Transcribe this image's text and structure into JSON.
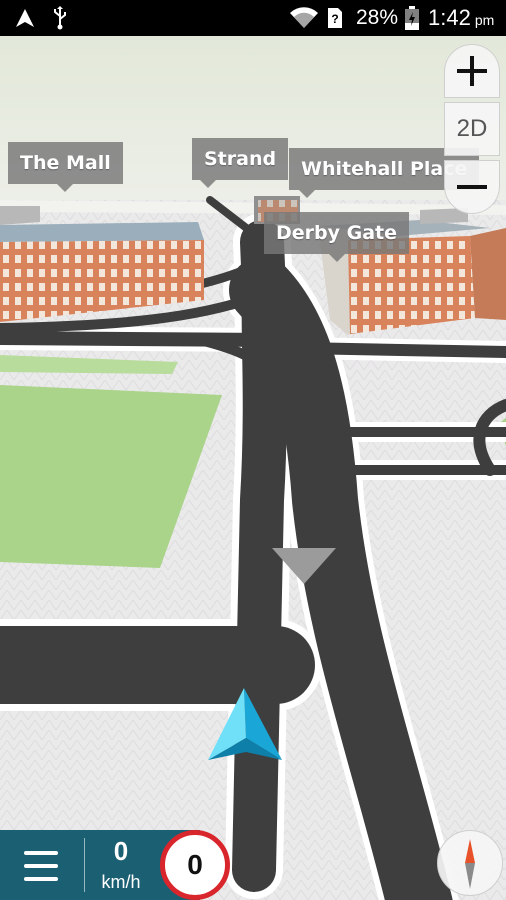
{
  "status_bar": {
    "battery": "28%",
    "time": "1:42",
    "ampm": "pm",
    "icons": [
      "navigation-arrow-icon",
      "usb-icon",
      "wifi-icon",
      "sim-alert-icon",
      "battery-charging-icon"
    ]
  },
  "map": {
    "street_labels": [
      "The Mall",
      "Strand",
      "Whitehall Place",
      "Derby Gate"
    ],
    "colors": {
      "ground": "#e9e8e9",
      "road": "#3e3e3e",
      "road_edge": "#ffffff",
      "park": "#a9d48a",
      "building_brick": "#d6855e",
      "roof": "#8fa3ae",
      "position_arrow": "#36c8ee"
    }
  },
  "zoom_controls": {
    "zoom_in": "+",
    "view_mode": "2D",
    "zoom_out": "−"
  },
  "bottom_bar": {
    "speed": "0",
    "speed_unit": "km/h",
    "speed_limit": "0"
  }
}
